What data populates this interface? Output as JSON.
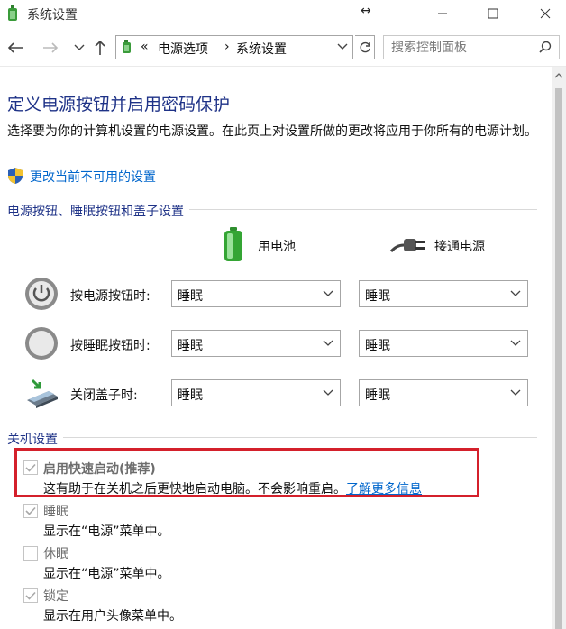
{
  "window": {
    "title": "系统设置",
    "resize_glyph": "↔"
  },
  "nav": {
    "breadcrumb_sep": "«",
    "crumbs": [
      "电源选项",
      "系统设置"
    ],
    "crumb_arrow": "›",
    "search_placeholder": "搜索控制面板"
  },
  "page": {
    "heading": "定义电源按钮并启用密码保护",
    "description": "选择要为你的计算机设置的电源设置。在此页上对设置所做的更改将应用于你所有的电源计划。",
    "change_link": "更改当前不可用的设置"
  },
  "buttons_section": {
    "title": "电源按钮、睡眠按钮和盖子设置",
    "col_battery": "用电池",
    "col_plugged": "接通电源",
    "rows": [
      {
        "label": "按电源按钮时:",
        "battery": "睡眠",
        "plugged": "睡眠",
        "icon": "power-button-icon"
      },
      {
        "label": "按睡眠按钮时:",
        "battery": "睡眠",
        "plugged": "睡眠",
        "icon": "sleep-button-icon"
      },
      {
        "label": "关闭盖子时:",
        "battery": "睡眠",
        "plugged": "睡眠",
        "icon": "laptop-lid-icon"
      }
    ]
  },
  "shutdown_section": {
    "title": "关机设置",
    "items": [
      {
        "label": "启用快速启动(推荐)",
        "checked": true,
        "desc": "这有助于在关机之后更快地启动电脑。不会影响重启。",
        "link": "了解更多信息"
      },
      {
        "label": "睡眠",
        "checked": true,
        "desc": "显示在“电源”菜单中。"
      },
      {
        "label": "休眠",
        "checked": false,
        "desc": "显示在“电源”菜单中。"
      },
      {
        "label": "锁定",
        "checked": true,
        "desc": "显示在用户头像菜单中。"
      }
    ]
  },
  "colors": {
    "heading_blue": "#1e3287",
    "link_blue": "#0066cc",
    "highlight_red": "#d4202b"
  }
}
